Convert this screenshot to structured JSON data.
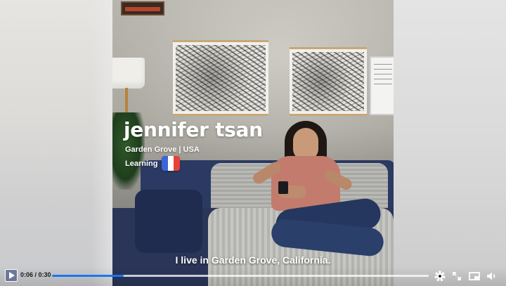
{
  "overlay": {
    "name": "jennifer tsan",
    "location": "Garden Grove | USA",
    "learning_label": "Learning",
    "learning_flag": "french-flag"
  },
  "subtitle": "I live in Garden Grove, California.",
  "controls": {
    "current_time": "0:06",
    "separator": " / ",
    "duration": "0:30",
    "progress_fraction": 0.19,
    "progress_color": "#1877f2",
    "icons": [
      "play-icon",
      "settings-icon",
      "fullscreen-icon",
      "picture-in-picture-icon",
      "volume-icon"
    ]
  },
  "colors": {
    "flag_blue": "#3a66d8",
    "flag_white": "#ffffff",
    "flag_red": "#e8413b"
  }
}
